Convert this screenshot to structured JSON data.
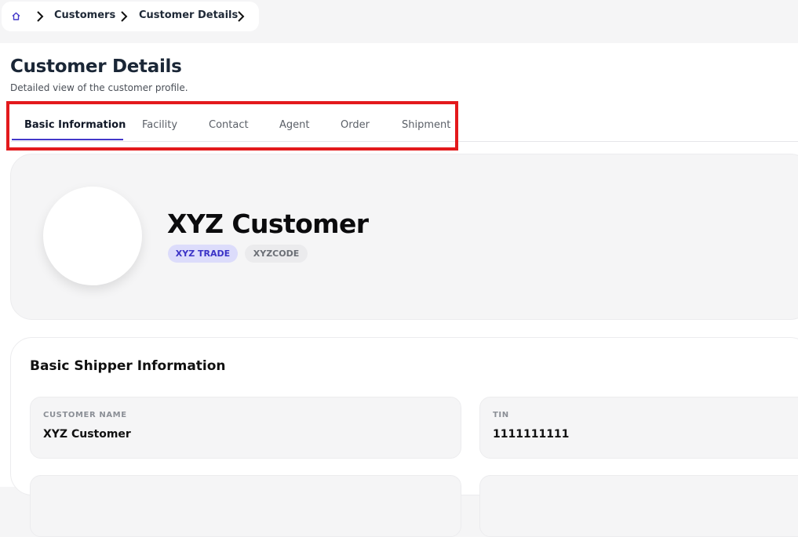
{
  "breadcrumb": {
    "home_icon": "home-icon",
    "items": [
      "Customers",
      "Customer Details"
    ]
  },
  "header": {
    "title": "Customer Details",
    "subtitle": "Detailed view of the customer profile."
  },
  "tabs": [
    {
      "label": "Basic Information",
      "active": true
    },
    {
      "label": "Facility",
      "active": false
    },
    {
      "label": "Contact",
      "active": false
    },
    {
      "label": "Agent",
      "active": false
    },
    {
      "label": "Order",
      "active": false
    },
    {
      "label": "Shipment",
      "active": false
    }
  ],
  "profile": {
    "name": "XYZ Customer",
    "badges": [
      "XYZ TRADE",
      "XYZCODE"
    ]
  },
  "basic_shipper": {
    "title": "Basic Shipper Information",
    "fields": [
      {
        "label": "CUSTOMER NAME",
        "value": "XYZ Customer"
      },
      {
        "label": "TIN",
        "value": "1111111111"
      }
    ]
  },
  "colors": {
    "accent": "#4338ca",
    "highlight": "#e3191c",
    "badge_trade_bg": "#dcdcfb",
    "badge_trade_text": "#3b33c7"
  }
}
